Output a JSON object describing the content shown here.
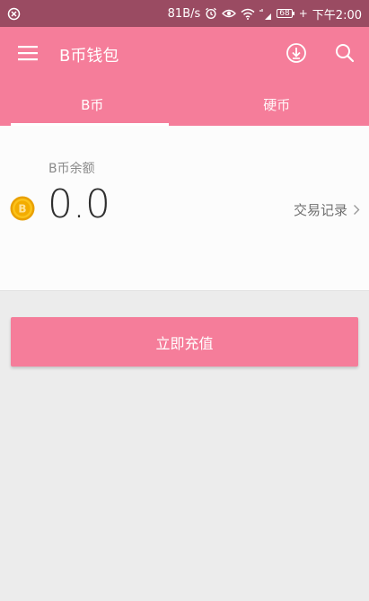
{
  "status_bar": {
    "speed": "81B/s",
    "battery": "68",
    "time": "下午2:00"
  },
  "app_bar": {
    "title": "B币钱包"
  },
  "tabs": [
    {
      "label": "B币",
      "active": true
    },
    {
      "label": "硬币",
      "active": false
    }
  ],
  "balance": {
    "label": "B币余额",
    "value": "0.0",
    "history_label": "交易记录"
  },
  "actions": {
    "recharge_label": "立即充值"
  },
  "colors": {
    "accent": "#f57d9a",
    "status_bar": "#9a4b62",
    "coin": "#f5b400"
  }
}
